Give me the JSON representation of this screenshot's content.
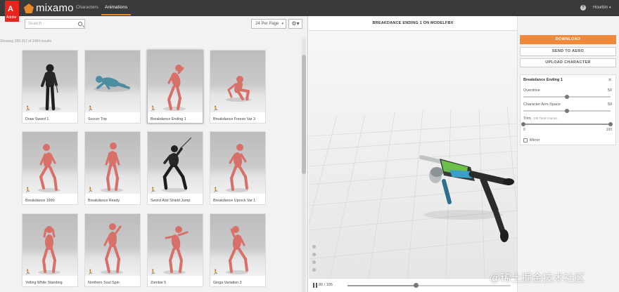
{
  "app": {
    "adobe_mark": "A",
    "adobe_word": "Adobe",
    "logo": "mixamo"
  },
  "nav": {
    "tabs": [
      {
        "label": "Characters",
        "active": false
      },
      {
        "label": "Animations",
        "active": true
      }
    ],
    "help_icon": "?",
    "user": "Hourbin",
    "user_caret": "▾"
  },
  "toolbar": {
    "search_placeholder": "Search",
    "per_page": "24 Per Page",
    "per_page_caret": "▾",
    "settings_icon": "⚙▾"
  },
  "results": {
    "count_text": "Showing 289-312 of 2484 results"
  },
  "cards": [
    {
      "label": "Draw Sword 1",
      "selected": false
    },
    {
      "label": "Soccer Trip",
      "selected": false
    },
    {
      "label": "Breakdance Ending 1",
      "selected": true
    },
    {
      "label": "Breakdance Freeze Var 3",
      "selected": false
    },
    {
      "label": "Breakdance 1990",
      "selected": false
    },
    {
      "label": "Breakdance Ready",
      "selected": false
    },
    {
      "label": "Sword And Shield Jump",
      "selected": false
    },
    {
      "label": "Breakdance Uprock Var 1",
      "selected": false
    },
    {
      "label": "Yelling While Standing",
      "selected": false
    },
    {
      "label": "Northern Soul Spin",
      "selected": false
    },
    {
      "label": "Zombie 5",
      "selected": false
    },
    {
      "label": "Ginga Variation 3",
      "selected": false
    }
  ],
  "viewer": {
    "title": "BREAKDANCE ENDING 1 ON MODELFBX",
    "frame": "86 / 195",
    "progress": 0.42
  },
  "actions": {
    "download": "DOWNLOAD",
    "send_to_aero": "SEND TO AERO",
    "upload_character": "UPLOAD CHARACTER"
  },
  "settings": {
    "title": "Breakdance Ending 1",
    "close_icon": "✕",
    "overdrive": {
      "label": "Overdrive",
      "value": "50",
      "level": 0.5
    },
    "arm_space": {
      "label": "Character Arm-Space",
      "value": "50",
      "level": 0.5
    },
    "trim": {
      "label": "Trim",
      "sub": "195 Total Frames",
      "min": "0",
      "max": "100"
    },
    "mirror": {
      "label": "Mirror",
      "checked": false
    }
  },
  "watermark": "@稀土掘金技术社区",
  "colors": {
    "accent": "#f0893a",
    "topbar": "#3a3a3a",
    "adobe_red": "#e8251d",
    "skin": "#d8706a"
  }
}
